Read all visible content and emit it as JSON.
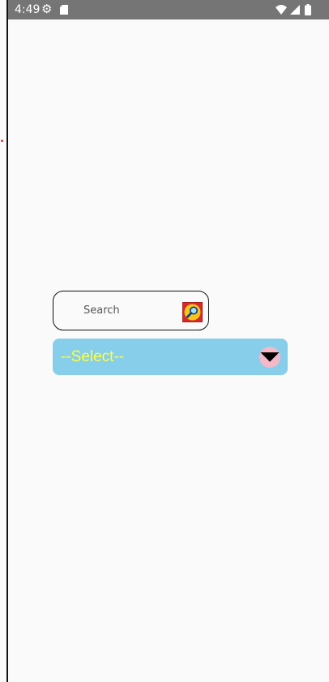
{
  "status_bar": {
    "time": "4:49",
    "icons": [
      "settings-gear-icon",
      "sd-card-icon",
      "wifi-icon",
      "cell-signal-icon",
      "battery-icon"
    ]
  },
  "search": {
    "placeholder": "Search",
    "value": "",
    "button_icon": "magnifier-icon"
  },
  "select": {
    "selected": "--Select--",
    "arrow_icon": "dropdown-arrow-icon"
  },
  "colors": {
    "status_bar_bg": "#757575",
    "page_bg": "#fafafa",
    "select_bg": "#87ceeb",
    "select_text": "#ffff3c",
    "arrow_bg": "#f3b8c9",
    "search_button_bg": "#d42a2a"
  }
}
